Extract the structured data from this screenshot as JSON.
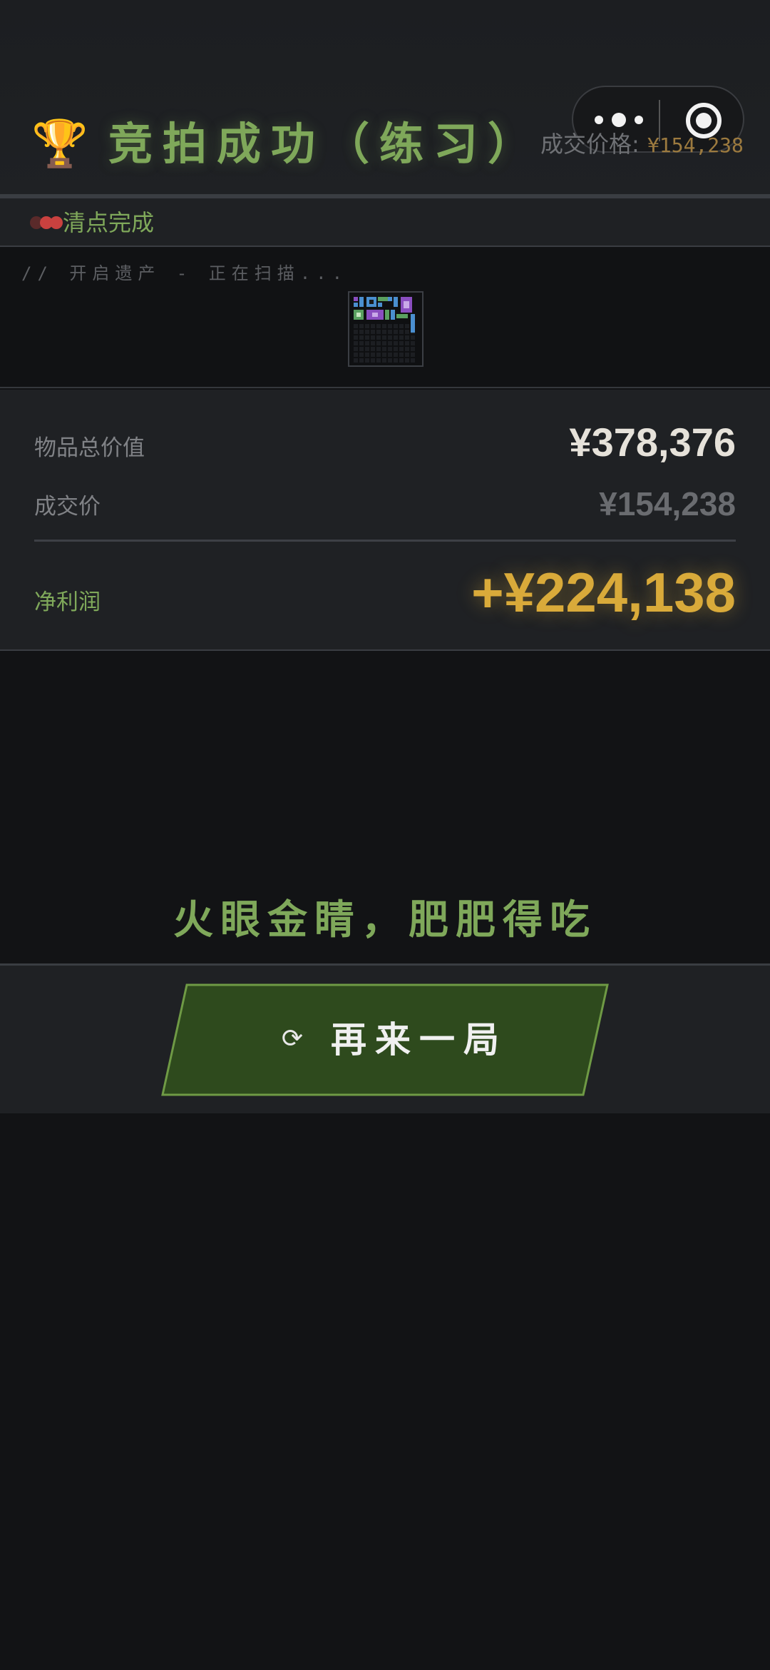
{
  "header": {
    "title": "竞拍成功（练习）",
    "price_label": "成交价格:",
    "price_value": "¥154,238",
    "trophy_icon": "trophy-icon"
  },
  "capsule": {
    "more_icon": "more-dots-icon",
    "close_icon": "target-close-icon"
  },
  "status": {
    "text": "清点完成",
    "dot_colors": [
      "#5a2a2a",
      "#c9413f",
      "#c9413f"
    ]
  },
  "scan": {
    "text": "// 开启遗产 - 正在扫描..."
  },
  "values": {
    "total_label": "物品总价值",
    "total_value": "¥378,376",
    "deal_label": "成交价",
    "deal_value": "¥154,238",
    "profit_label": "净利润",
    "profit_value": "+¥224,138"
  },
  "slogan": "火眼金睛，肥肥得吃",
  "action": {
    "again_label": "再来一局",
    "again_icon": "refresh-icon"
  },
  "colors": {
    "accent_green": "#7fa85a",
    "gold": "#d9aa3a",
    "button_green": "#2e4a1d"
  }
}
